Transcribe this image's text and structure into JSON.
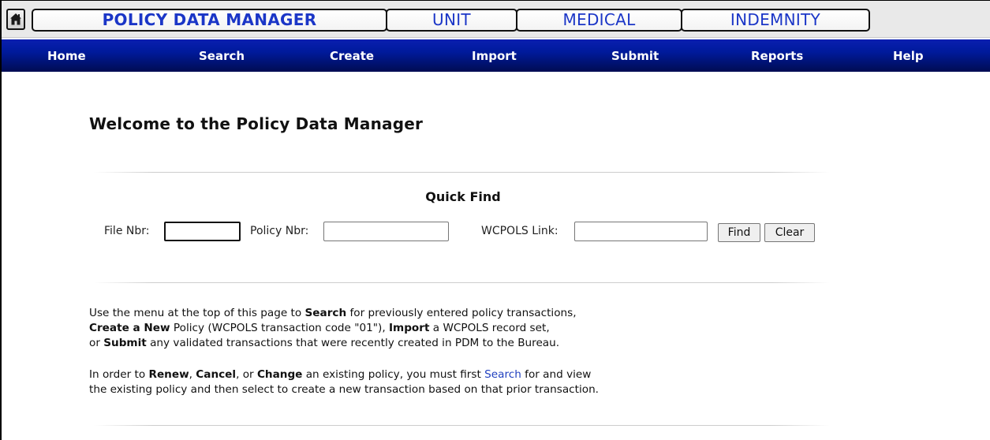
{
  "tabs": [
    {
      "label": "POLICY DATA MANAGER",
      "active": true
    },
    {
      "label": "UNIT",
      "active": false
    },
    {
      "label": "MEDICAL",
      "active": false
    },
    {
      "label": "INDEMNITY",
      "active": false
    }
  ],
  "home_icon": "home-icon",
  "menu": [
    "Home",
    "Search",
    "Create",
    "Import",
    "Submit",
    "Reports",
    "Help"
  ],
  "welcome_title": "Welcome to the Policy Data Manager",
  "quick_find": {
    "title": "Quick Find",
    "file_nbr_label": "File Nbr:",
    "file_nbr_value": "",
    "policy_nbr_label": "Policy Nbr:",
    "policy_nbr_value": "",
    "wcpols_label": "WCPOLS Link:",
    "wcpols_value": "",
    "find_label": "Find",
    "clear_label": "Clear"
  },
  "instructions": {
    "p1_line1": {
      "a": "Use the menu at the top of this page to ",
      "b": "Search",
      "c": " for previously entered policy transactions,"
    },
    "p1_line2": {
      "a": "Create a New",
      "b": " Policy (WCPOLS transaction code \"01\"), ",
      "c": "Import",
      "d": " a WCPOLS record set,"
    },
    "p1_line3": {
      "a": "or ",
      "b": "Submit",
      "c": " any validated transactions that were recently created in PDM to the Bureau."
    },
    "p2_line1": {
      "a": "In order to ",
      "b": "Renew",
      "c": ", ",
      "d": "Cancel",
      "e": ", or ",
      "f": "Change",
      "g": " an existing policy, you must first ",
      "link": "Search",
      "h": " for and view"
    },
    "p2_line2": "the existing policy and then select to create a new transaction based on that prior transaction."
  },
  "colors": {
    "tab_text": "#1b36c7",
    "menu_bar": "#001a9c",
    "link": "#1f3fbf"
  }
}
